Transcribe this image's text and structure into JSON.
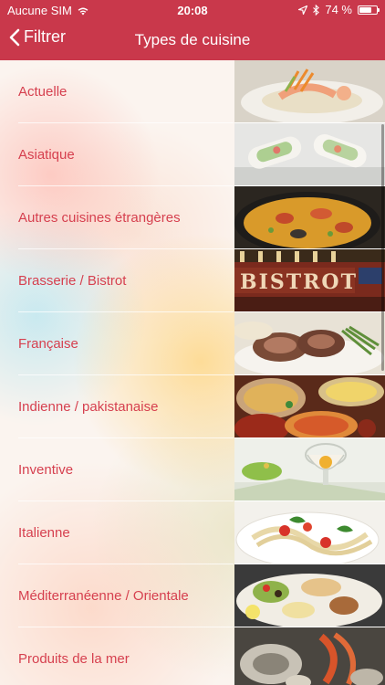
{
  "status_bar": {
    "carrier": "Aucune SIM",
    "time": "20:08",
    "battery_label": "74 %",
    "battery_level": 0.74
  },
  "nav": {
    "back_label": "Filtrer",
    "title": "Types de cuisine"
  },
  "list": {
    "items": [
      {
        "label": "Actuelle"
      },
      {
        "label": "Asiatique"
      },
      {
        "label": "Autres cuisines étrangères"
      },
      {
        "label": "Brasserie / Bistrot"
      },
      {
        "label": "Française"
      },
      {
        "label": "Indienne / pakistanaise"
      },
      {
        "label": "Inventive"
      },
      {
        "label": "Italienne"
      },
      {
        "label": "Méditerranéenne / Orientale"
      },
      {
        "label": "Produits de la mer"
      }
    ]
  },
  "thumbnails": [
    {
      "text": ""
    },
    {
      "text": ""
    },
    {
      "text": ""
    },
    {
      "text": "BISTROT"
    },
    {
      "text": ""
    },
    {
      "text": ""
    },
    {
      "text": ""
    },
    {
      "text": ""
    },
    {
      "text": ""
    },
    {
      "text": ""
    }
  ]
}
